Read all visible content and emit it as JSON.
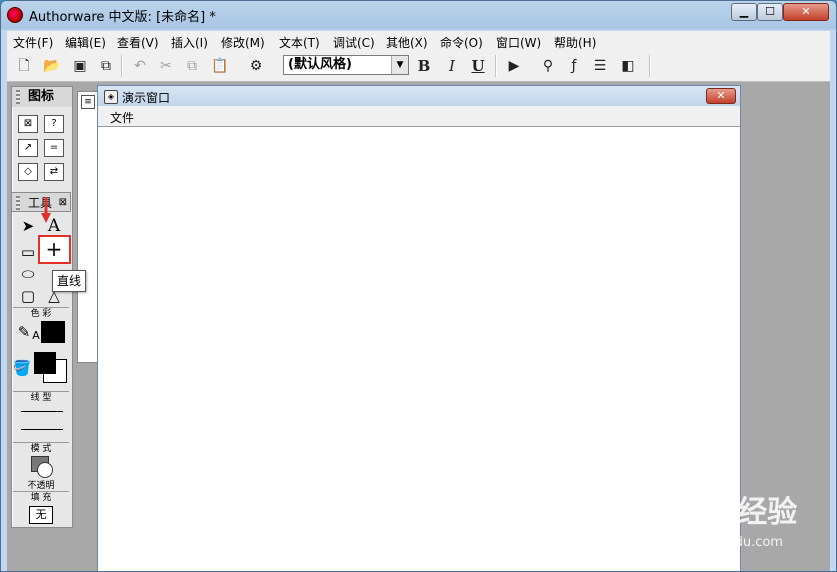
{
  "window": {
    "title": "Authorware 中文版: [未命名] *",
    "min_label": "▁",
    "max_label": "☐",
    "close_label": "✕"
  },
  "menu": [
    "文件(F)",
    "编辑(E)",
    "查看(V)",
    "插入(I)",
    "修改(M)",
    "文本(T)",
    "调试(C)",
    "其他(X)",
    "命令(O)",
    "窗口(W)",
    "帮助(H)"
  ],
  "toolbar": {
    "style_select": "(默认风格)",
    "bold": "B",
    "italic": "I",
    "underline": "U"
  },
  "icon_palette": {
    "title": "图标"
  },
  "tools_palette": {
    "title": "工具",
    "tooltip": "直线",
    "text_tool": "A",
    "pencil_label": "A",
    "section_color": "色 彩",
    "section_line": "线 型",
    "section_mode": "模 式",
    "mode_value": "不透明",
    "section_fill": "填 充",
    "fill_value": "无"
  },
  "presentation": {
    "title": "演示窗口",
    "menu_file": "文件",
    "close_label": "✕"
  },
  "watermark": {
    "main": "Baidu经验",
    "sub": "jingyan.baidu.com"
  },
  "colors": {
    "highlight": "#e0312a",
    "titlebar": "#bcd3eb"
  }
}
